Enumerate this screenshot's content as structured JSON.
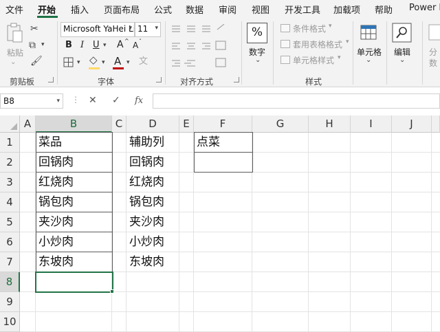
{
  "menu": {
    "tabs": [
      {
        "label": "文件",
        "active": false
      },
      {
        "label": "开始",
        "active": true
      },
      {
        "label": "插入",
        "active": false
      },
      {
        "label": "页面布局",
        "active": false
      },
      {
        "label": "公式",
        "active": false
      },
      {
        "label": "数据",
        "active": false
      },
      {
        "label": "审阅",
        "active": false
      },
      {
        "label": "视图",
        "active": false
      },
      {
        "label": "开发工具",
        "active": false
      },
      {
        "label": "加载项",
        "active": false
      },
      {
        "label": "帮助",
        "active": false
      },
      {
        "label": "Power P",
        "active": false
      }
    ]
  },
  "ribbon": {
    "clipboard": {
      "group_label": "剪贴板",
      "paste_label": "粘贴"
    },
    "font": {
      "group_label": "字体",
      "font_name": "Microsoft YaHei Li",
      "font_size": "11",
      "bold": "B",
      "italic": "I",
      "underline": "U",
      "grow": "A",
      "shrink": "A",
      "font_color_letter": "A",
      "fill_color": "#ffd966",
      "font_color": "#c00000"
    },
    "alignment": {
      "group_label": "对齐方式"
    },
    "number": {
      "group_label": "数字",
      "button_label": "数字",
      "icon": "%"
    },
    "styles": {
      "group_label": "样式",
      "conditional_format": "条件格式",
      "table_format": "套用表格格式",
      "cell_style": "单元格样式"
    },
    "cells": {
      "button_label": "单元格"
    },
    "editing": {
      "button_label": "编辑"
    },
    "partial": {
      "line1": "分",
      "line2": "数"
    }
  },
  "formula_bar": {
    "name_box": "B8",
    "cancel_icon": "✕",
    "enter_icon": "✓",
    "fx_label": "fx",
    "value": ""
  },
  "columns": [
    "A",
    "B",
    "C",
    "D",
    "E",
    "F",
    "G",
    "H",
    "I",
    "J"
  ],
  "selected_column": "B",
  "rows": [
    "1",
    "2",
    "3",
    "4",
    "5",
    "6",
    "7",
    "8",
    "9",
    "10"
  ],
  "selected_row": "8",
  "cells": {
    "B": [
      "菜品",
      "回锅肉",
      "红烧肉",
      "锅包肉",
      "夹沙肉",
      "小炒肉",
      "东坡肉"
    ],
    "D": [
      "辅助列",
      "回锅肉",
      "红烧肉",
      "锅包肉",
      "夹沙肉",
      "小炒肉",
      "东坡肉"
    ],
    "F": [
      "点菜",
      ""
    ]
  }
}
